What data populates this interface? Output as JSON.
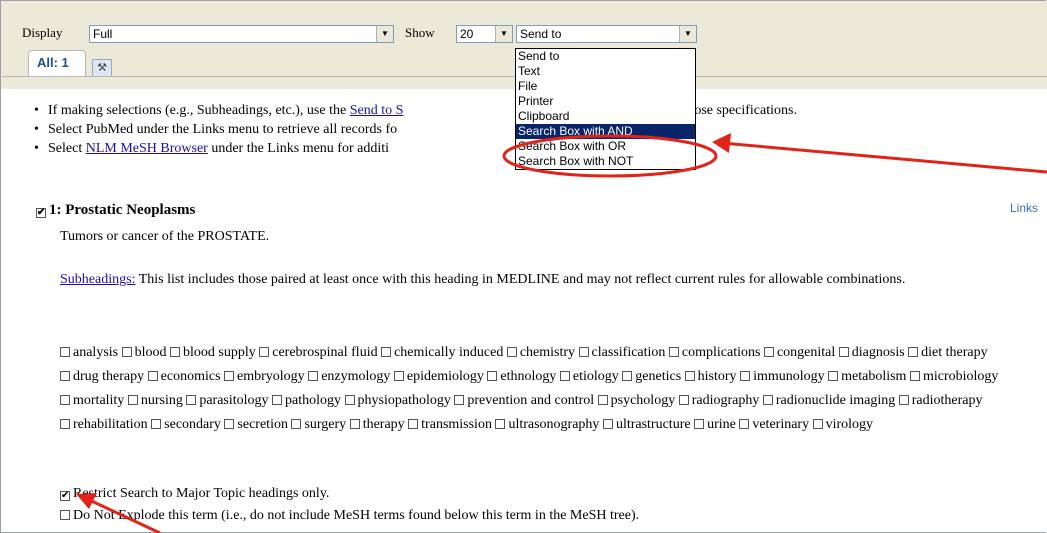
{
  "toolbar": {
    "display_label": "Display",
    "display_value": "Full",
    "show_label": "Show",
    "show_value": "20",
    "sendto_value": "Send to",
    "tab_all": "All: 1"
  },
  "dropdown": {
    "items": [
      "Send to",
      "Text",
      "File",
      "Printer",
      "Clipboard",
      "Search Box with AND",
      "Search Box with OR",
      "Search Box with NOT"
    ],
    "selected": "Search Box with AND"
  },
  "notes": {
    "n1_pre": "If making selections (e.g., Subheadings, etc.), use the ",
    "n1_link": "Send to S",
    "n1_post": "PubMed records with those specifications.",
    "n2": "Select PubMed under the Links menu to retrieve all records fo",
    "n3_pre": "Select ",
    "n3_link": "NLM MeSH Browser",
    "n3_post": " under the Links menu for additi"
  },
  "record": {
    "number": "1:",
    "title": "Prostatic Neoplasms",
    "links_label": "Links",
    "description": "Tumors or cancer of the PROSTATE.",
    "subheadings_link": "Subheadings:",
    "subheadings_text": " This list includes those paired at least once with this heading in MEDLINE and may not reflect current rules for allowable combinations."
  },
  "subheadings": [
    "analysis",
    "blood",
    "blood supply",
    "cerebrospinal fluid",
    "chemically induced",
    "chemistry",
    "classification",
    "complications",
    "congenital",
    "diagnosis",
    "diet therapy",
    "drug therapy",
    "economics",
    "embryology",
    "enzymology",
    "epidemiology",
    "ethnology",
    "etiology",
    "genetics",
    "history",
    "immunology",
    "metabolism",
    "microbiology",
    "mortality",
    "nursing",
    "parasitology",
    "pathology",
    "physiopathology",
    "prevention and control",
    "psychology",
    "radiography",
    "radionuclide imaging",
    "radiotherapy",
    "rehabilitation",
    "secondary",
    "secretion",
    "surgery",
    "therapy",
    "transmission",
    "ultrasonography",
    "ultrastructure",
    "urine",
    "veterinary",
    "virology"
  ],
  "options": {
    "restrict_major": "Restrict Search to Major Topic headings only.",
    "no_explode": "Do Not Explode this term (i.e., do not include MeSH terms found below this term in the MeSH tree)."
  },
  "colors": {
    "annotation_red": "#e2231a",
    "menu_highlight": "#0a246a"
  }
}
